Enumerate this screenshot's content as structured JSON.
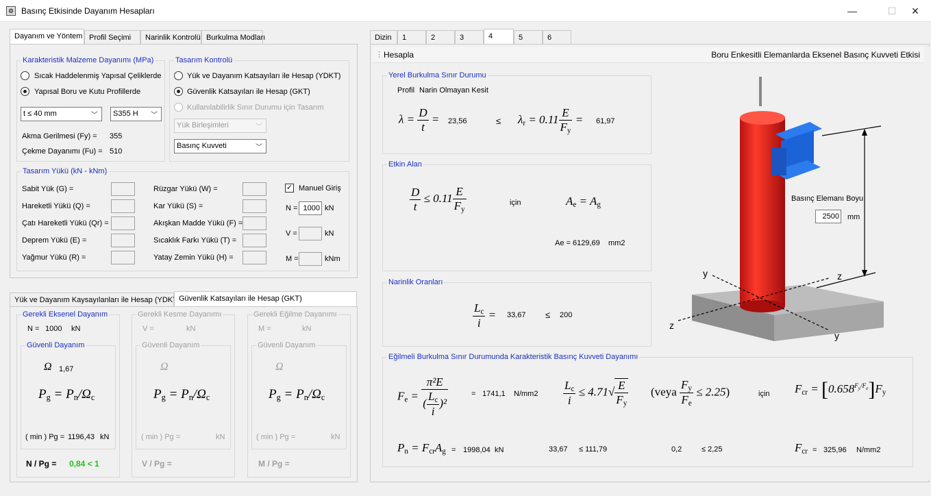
{
  "window": {
    "title": "Basınç Etkisinde Dayanım Hesapları",
    "icon": "app-icon",
    "min": "—",
    "max": "☐",
    "close": "✕"
  },
  "left_tabs": [
    "Dayanım ve Yöntem",
    "Profil Seçimi",
    "Narinlik Kontrolü",
    "Burkulma Modları"
  ],
  "material": {
    "title": "Karakteristik Malzeme Dayanımı (MPa)",
    "radio1": "Sıcak Haddelenmiş Yapısal Çeliklerde",
    "radio2": "Yapısal Boru ve Kutu Profillerde",
    "thickness": "t ≤ 40 mm",
    "steel": "S355 H",
    "fy_label": "Akma Gerilmesi (Fy) =",
    "fy_value": "355",
    "fu_label": "Çekme Dayanımı (Fu) =",
    "fu_value": "510"
  },
  "design": {
    "title": "Tasarım Kontrolü",
    "radio1": "Yük ve Dayanım Katsayıları ile Hesap (YDKT)",
    "radio2": "Güvenlik Katsayıları ile Hesap (GKT)",
    "radio3": "Kullanılabilirlik Sınır Durumu için Tasarım",
    "combo1": "Yük Birleşimleri",
    "combo2": "Basınç Kuvveti"
  },
  "loads": {
    "title": "Tasarım Yükü (kN - kNm)",
    "left": [
      "Sabit Yük (G) =",
      "Hareketli Yükü (Q) =",
      "Çatı Hareketli Yükü (Qr) =",
      "Deprem Yükü (E) =",
      "Yağmur Yükü (R) ="
    ],
    "mid": [
      "Rüzgar Yükü (W) =",
      "Kar Yükü (S) =",
      "Akışkan Madde Yükü (F) =",
      "Sıcaklık Farkı Yükü (T) =",
      "Yatay Zemin Yükü (H) ="
    ],
    "manual": "Manuel Giriş",
    "manual_check": "✓",
    "n_label": "N =",
    "n_value": "1000",
    "n_unit": "kN",
    "v_label": "V =",
    "v_unit": "kN",
    "m_label": "M =",
    "m_unit": "kNm"
  },
  "bottom_tabs": [
    "Yük ve Dayanım Kaysayılanları ile Hesap (YDKT)",
    "Güvenlik Katsayıları ile Hesap (GKT)"
  ],
  "axial": {
    "title": "Gerekli Eksenel Dayanım",
    "n_label": "N =",
    "n_value": "1000",
    "n_unit": "kN",
    "safe_title": "Güvenli Dayanım",
    "omega": "Ω",
    "omega_value": "1,67",
    "min_label": "( min ) Pg =",
    "min_value": "1196,43",
    "min_unit": "kN",
    "ratio_label": "N / Pg =",
    "ratio_value": "0,84 < 1"
  },
  "shear": {
    "title": "Gerekli Kesme Dayanımı",
    "v_label": "V =",
    "v_unit": "kN",
    "safe_title": "Güvenli Dayanım",
    "min_label": "( min ) Pg =",
    "min_unit": "kN",
    "ratio_label": "V / Pg ="
  },
  "bending": {
    "title": "Gerekli Eğilme Dayanımı",
    "m_label": "M =",
    "m_unit": "kN",
    "safe_title": "Güvenli Dayanım",
    "min_label": "( min ) Pg =",
    "min_unit": "kN",
    "ratio_label": "M / Pg ="
  },
  "right_tabs": [
    "Dizin",
    "1",
    "2",
    "3",
    "4",
    "5",
    "6"
  ],
  "toolbar": {
    "hesapla": "Hesapla",
    "title": "Boru Enkesitli Elemanlarda Eksenel Basınç Kuvveti Etkisi"
  },
  "local": {
    "title": "Yerel Burkulma Sınır Durumu",
    "profil_label": "Profil",
    "profil_value": "Narin Olmayan Kesit",
    "lambda_value": "23,56",
    "le": "≤",
    "lambda_r_value": "61,97"
  },
  "effective": {
    "title": "Etkin Alan",
    "icin": "için",
    "ae_label": "Ae =",
    "ae_value": "6129,69",
    "ae_unit": "mm2"
  },
  "slenderness": {
    "title": "Narinlik Oranları",
    "value": "33,67",
    "le": "≤",
    "limit": "200"
  },
  "buckling": {
    "title": "Eğilmeli Burkulma Sınır Durumunda Karakteristik Basınç Kuvveti Dayanımı",
    "fe_value": "1741,1",
    "fe_unit": "N/mm2",
    "icin": "için",
    "pn_value": "1998,04",
    "pn_unit": "kN",
    "slend_value": "33,67",
    "slend_limit": "≤ 111,79",
    "ratio_value": "0,2",
    "ratio_limit": "≤ 2,25",
    "fcr_value": "325,96",
    "fcr_unit": "N/mm2"
  },
  "figure": {
    "length_label": "Basınç Elemanı Boyu",
    "length_value": "2500",
    "length_unit": "mm",
    "axis_y": "y",
    "axis_z": "z",
    "colors": {
      "column": "#e02020",
      "beam": "#1d63d8",
      "base": "#8e8e8e"
    }
  }
}
